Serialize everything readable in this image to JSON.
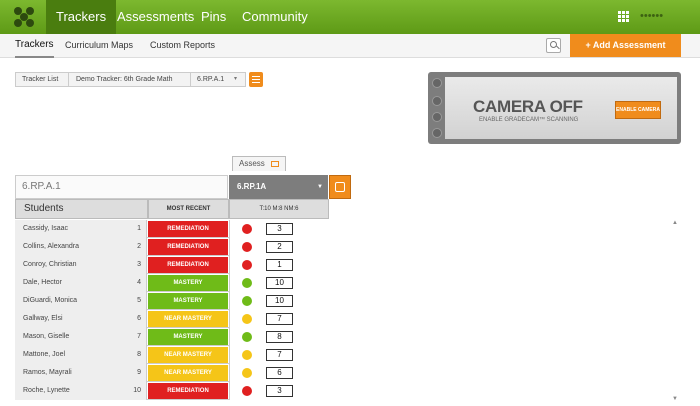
{
  "nav": {
    "items": [
      {
        "label": "Trackers",
        "active": true
      },
      {
        "label": "Assessments"
      },
      {
        "label": "Pins"
      },
      {
        "label": "Community"
      }
    ],
    "user_name": "••••••"
  },
  "subnav": {
    "items": [
      {
        "label": "Trackers",
        "active": true
      },
      {
        "label": "Curriculum Maps"
      },
      {
        "label": "Custom Reports"
      }
    ],
    "add_button": "+ Add Assessment"
  },
  "breadcrumb": [
    "Tracker List",
    "Demo Tracker: 6th Grade Math",
    "6.RP.A.1"
  ],
  "camera": {
    "title": "CAMERA OFF",
    "subtitle": "ENABLE GRADECAM™ SCANNING",
    "button": "ENABLE CAMERA"
  },
  "assess_tab": "Assess",
  "tracker": {
    "standard_input": "6.RP.A.1",
    "selected_standard": "6.RP.1A",
    "headers": {
      "students": "Students",
      "recent": "MOST RECENT",
      "meta": "T:10 M:8 NM:6"
    }
  },
  "colors": {
    "remediation": "#e02020",
    "mastery": "#6fbb18",
    "near_mastery": "#f5c518",
    "accent": "#f08c1c"
  },
  "students": [
    {
      "name": "Cassidy, Isaac",
      "num": "1",
      "status": "REMEDIATION",
      "score": "3"
    },
    {
      "name": "Collins, Alexandra",
      "num": "2",
      "status": "REMEDIATION",
      "score": "2"
    },
    {
      "name": "Conroy, Christian",
      "num": "3",
      "status": "REMEDIATION",
      "score": "1"
    },
    {
      "name": "Dale, Hector",
      "num": "4",
      "status": "MASTERY",
      "score": "10"
    },
    {
      "name": "DiGuardi, Monica",
      "num": "5",
      "status": "MASTERY",
      "score": "10"
    },
    {
      "name": "Gallway, Elsi",
      "num": "6",
      "status": "NEAR MASTERY",
      "score": "7"
    },
    {
      "name": "Mason, Giselle",
      "num": "7",
      "status": "MASTERY",
      "score": "8"
    },
    {
      "name": "Mattone, Joel",
      "num": "8",
      "status": "NEAR MASTERY",
      "score": "7"
    },
    {
      "name": "Ramos, Mayrali",
      "num": "9",
      "status": "NEAR MASTERY",
      "score": "6"
    },
    {
      "name": "Roche, Lynette",
      "num": "10",
      "status": "REMEDIATION",
      "score": "3"
    }
  ]
}
